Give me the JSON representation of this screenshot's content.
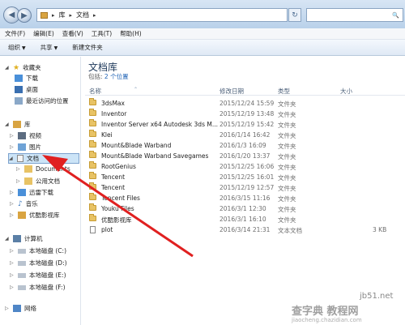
{
  "address": {
    "crumbs": [
      "库",
      "文档"
    ]
  },
  "menu": [
    "文件(F)",
    "编辑(E)",
    "查看(V)",
    "工具(T)",
    "帮助(H)"
  ],
  "toolbar": {
    "organize": "组织",
    "share": "共享",
    "new_folder": "新建文件夹"
  },
  "sidebar": {
    "favorites": "收藏夹",
    "fav_items": [
      "下载",
      "桌面",
      "最近访问的位置"
    ],
    "libraries": "库",
    "lib_items": [
      "视频",
      "图片",
      "文档",
      "Documents",
      "公用文档",
      "迅雷下载",
      "音乐",
      "优酷影视库"
    ],
    "computer": "计算机",
    "drives": [
      "本地磁盘 (C:)",
      "本地磁盘 (D:)",
      "本地磁盘 (E:)",
      "本地磁盘 (F:)"
    ],
    "network": "网络"
  },
  "library": {
    "title": "文档库",
    "includes_label": "包括:",
    "includes_link": "2 个位置"
  },
  "columns": {
    "name": "名称",
    "date": "修改日期",
    "type": "类型",
    "size": "大小"
  },
  "files": [
    {
      "name": "3dsMax",
      "date": "2015/12/24 15:59",
      "type": "文件夹",
      "size": "",
      "icon": "folder"
    },
    {
      "name": "Inventor",
      "date": "2015/12/19 13:48",
      "type": "文件夹",
      "size": "",
      "icon": "folder"
    },
    {
      "name": "Inventor Server x64 Autodesk 3ds M...",
      "date": "2015/12/19 15:42",
      "type": "文件夹",
      "size": "",
      "icon": "folder"
    },
    {
      "name": "Klei",
      "date": "2016/1/14 16:42",
      "type": "文件夹",
      "size": "",
      "icon": "folder"
    },
    {
      "name": "Mount&Blade Warband",
      "date": "2016/1/3 16:09",
      "type": "文件夹",
      "size": "",
      "icon": "folder"
    },
    {
      "name": "Mount&Blade Warband Savegames",
      "date": "2016/1/20 13:37",
      "type": "文件夹",
      "size": "",
      "icon": "folder"
    },
    {
      "name": "RootGenius",
      "date": "2015/12/25 16:06",
      "type": "文件夹",
      "size": "",
      "icon": "folder"
    },
    {
      "name": "Tencent",
      "date": "2015/12/25 16:01",
      "type": "文件夹",
      "size": "",
      "icon": "folder"
    },
    {
      "name": "Tencent",
      "date": "2015/12/19 12:57",
      "type": "文件夹",
      "size": "",
      "icon": "folder"
    },
    {
      "name": "Tencent Files",
      "date": "2016/3/15 11:16",
      "type": "文件夹",
      "size": "",
      "icon": "folder"
    },
    {
      "name": "Youku Files",
      "date": "2016/3/1 12:30",
      "type": "文件夹",
      "size": "",
      "icon": "folder"
    },
    {
      "name": "优酷影视库",
      "date": "2016/3/1 16:10",
      "type": "文件夹",
      "size": "",
      "icon": "folder"
    },
    {
      "name": "plot",
      "date": "2016/3/14 21:31",
      "type": "文本文档",
      "size": "3 KB",
      "icon": "text-file"
    }
  ],
  "watermark": {
    "site": "jb51.net",
    "brand": "查字典 教程网",
    "url": "jiaocheng.chazidian.com"
  },
  "colors": {
    "arrow": "#e02020",
    "selection": "#cce4f7",
    "accent": "#1a5fb4"
  }
}
